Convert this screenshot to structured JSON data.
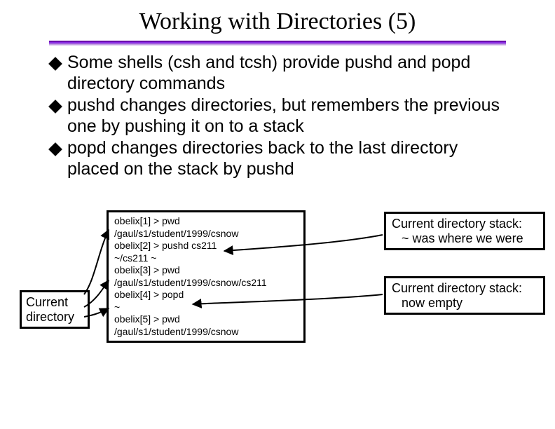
{
  "title": "Working with Directories (5)",
  "bullets": [
    {
      "pre": "Some shells (csh and tcsh) provide ",
      "cmd1": "pushd",
      "mid": " and ",
      "cmd2": "popd",
      "post": " directory commands"
    },
    {
      "pre": "",
      "cmd1": "pushd",
      "mid": " changes directories, but remembers the previous one by pushing it on to a stack",
      "cmd2": "",
      "post": ""
    },
    {
      "pre": "",
      "cmd1": "popd",
      "mid": " changes directories back to the last directory placed on the stack by ",
      "cmd2": "pushd",
      "post": ""
    }
  ],
  "terminal": "obelix[1] > pwd\n/gaul/s1/student/1999/csnow\nobelix[2] > pushd cs211\n~/cs211 ~\nobelix[3] > pwd\n/gaul/s1/student/1999/csnow/cs211\nobelix[4] > popd\n~\nobelix[5] > pwd\n/gaul/s1/student/1999/csnow",
  "curdir": {
    "l1": "Current",
    "l2": "directory"
  },
  "stack1": {
    "l1": "Current directory stack:",
    "l2": "~ was where we were"
  },
  "stack2": {
    "l1": "Current directory stack:",
    "l2": "now empty"
  }
}
